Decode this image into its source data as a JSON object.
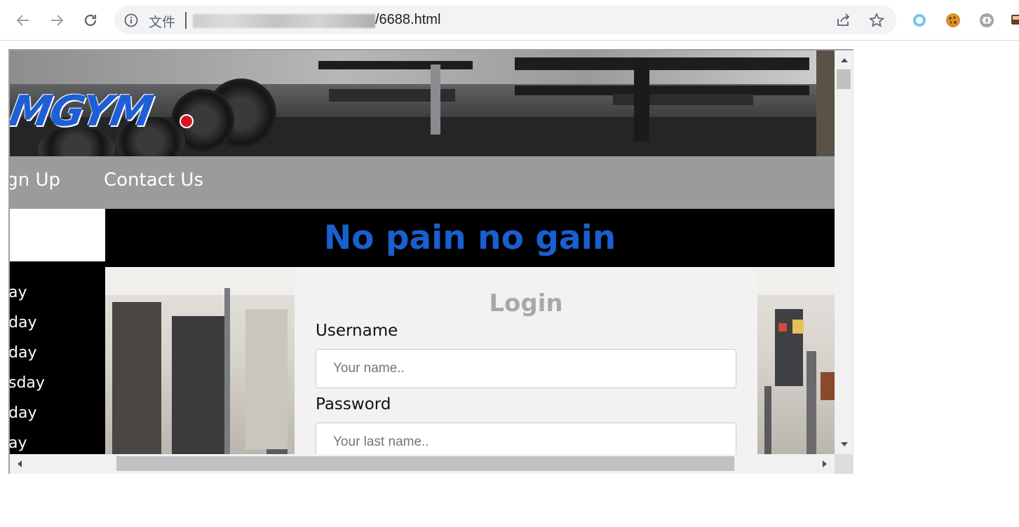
{
  "browser": {
    "url_scheme_label": "文件",
    "url_visible": "/6688.html"
  },
  "site": {
    "logo_text": "MGYM",
    "nav_items": [
      "ign Up",
      "Contact Us"
    ],
    "headline": "No pain no gain",
    "days": [
      "ay",
      "day",
      "day",
      "sday",
      "day",
      "ay"
    ]
  },
  "login": {
    "title": "Login",
    "username_label": "Username",
    "username_placeholder": "Your name..",
    "password_label": "Password",
    "password_placeholder": "Your last name.."
  },
  "colors": {
    "headline": "#1a5fd0",
    "navbar": "#9b9b9b",
    "login_title": "#a8a8a8"
  }
}
